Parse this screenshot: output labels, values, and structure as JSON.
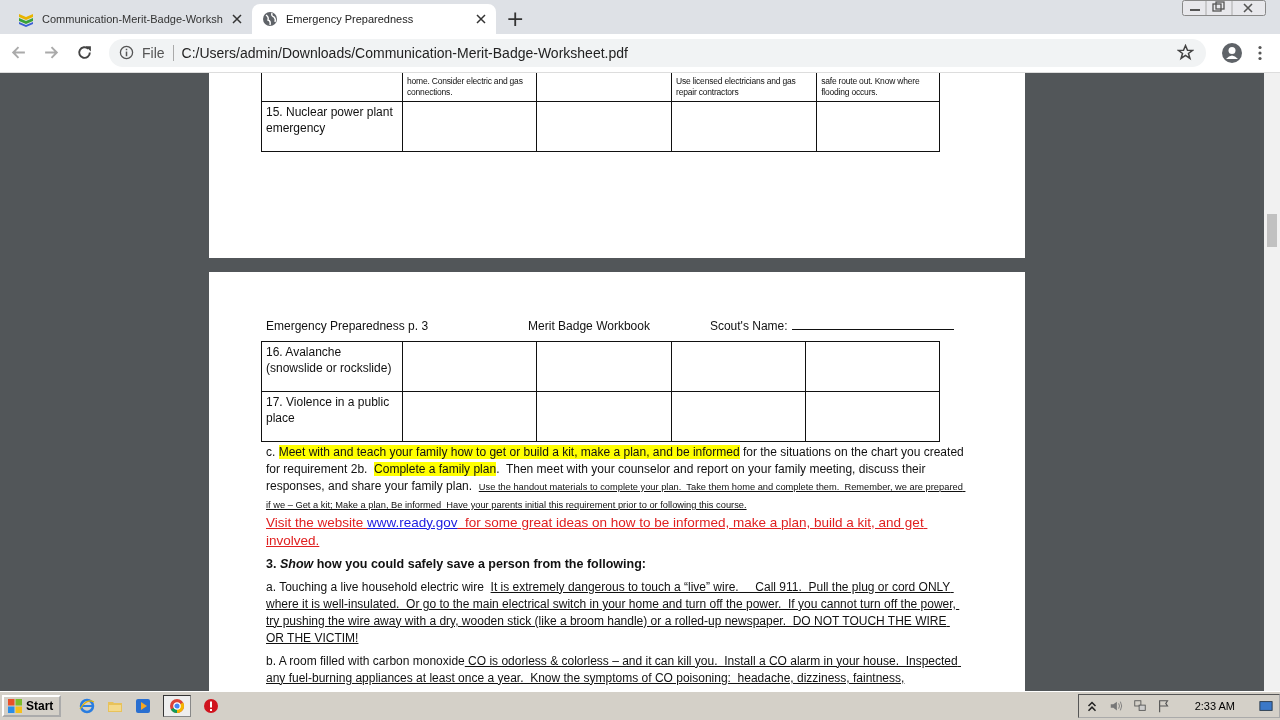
{
  "browser": {
    "tabs": [
      {
        "title": "Communication-Merit-Badge-Worksh",
        "selected": false
      },
      {
        "title": "Emergency Preparedness",
        "selected": true
      }
    ],
    "new_tab": "+",
    "address": {
      "security_label": "File",
      "url": "C:/Users/admin/Downloads/Communication-Merit-Badge-Worksheet.pdf"
    }
  },
  "document": {
    "page_1": {
      "table_rows": [
        {
          "cells": [
            null,
            "home.  Consider electric and gas connections.",
            null,
            "Use licensed electricians and gas repair contractors",
            "safe route out.  Know where flooding occurs."
          ]
        },
        {
          "cells": [
            "15. Nuclear power plant emergency",
            null,
            null,
            null,
            null
          ]
        }
      ]
    },
    "page_2": {
      "header": {
        "title": "Emergency Preparedness p. 3",
        "subtitle": "Merit Badge Workbook",
        "name_label": "Scout's Name:"
      },
      "table_rows": [
        {
          "cells": [
            "16. Avalanche (snowslide or rockslide)",
            null,
            null,
            null,
            null
          ]
        },
        {
          "cells": [
            "17. Violence in a public place",
            null,
            null,
            null,
            null
          ]
        }
      ],
      "paragraphs": [
        {
          "kind": "item",
          "segments": [
            {
              "kind": "text",
              "text": "c. "
            },
            {
              "kind": "highlight",
              "text": "Meet with and teach your family how to get or build a kit, make a plan, and be informed"
            },
            {
              "kind": "text",
              "text": " for the situations on the chart you created for requirement 2b.  "
            },
            {
              "kind": "highlight",
              "text": "Complete a family plan"
            },
            {
              "kind": "text",
              "text": ".  Then meet with your counselor and report on your family meeting, discuss their responses, and share your family plan.  "
            },
            {
              "kind": "note",
              "text": "Use the handout materials to complete your plan.  Take them home and complete them.  Remember, we are prepared if we – Get a kit; Make a plan, Be informed  Have your parents initial this requirement prior to or following this course."
            }
          ]
        },
        {
          "kind": "web",
          "segments": [
            {
              "kind": "text",
              "text": "Visit the website "
            },
            {
              "kind": "link",
              "text": "www.ready.gov"
            },
            {
              "kind": "text",
              "text": "  for some great ideas on how to be informed, make a plan, build a kit, and get involved."
            }
          ]
        },
        {
          "kind": "heading",
          "text": "3. *Show* how you could safely save a person from the following:"
        },
        {
          "kind": "item",
          "segments": [
            {
              "kind": "text",
              "text": "a. Touching a live household electric wire  "
            },
            {
              "kind": "answer",
              "text": "It is extremely dangerous to touch a “live” wire.     Call 911.  Pull the plug or cord ONLY where it is well-insulated.  Or go to the main electrical switch in your home and turn off the power.  If you cannot turn off the power, try pushing the wire away with a dry, wooden stick (like a broom handle) or a rolled-up newspaper.  DO NOT TOUCH THE WIRE OR THE VICTIM!"
            }
          ]
        },
        {
          "kind": "item",
          "segments": [
            {
              "kind": "text",
              "text": "b. A room filled with carbon monoxide"
            },
            {
              "kind": "answer",
              "text": " CO is odorless & colorless – and it can kill you.  Install a CO alarm in your house.  Inspected any fuel-burning appliances at least once a year.  Know the symptoms of CO poisoning:  headache, dizziness, faintness,"
            }
          ]
        }
      ]
    }
  },
  "taskbar": {
    "start": "Start",
    "clock": "2:33 AM"
  }
}
